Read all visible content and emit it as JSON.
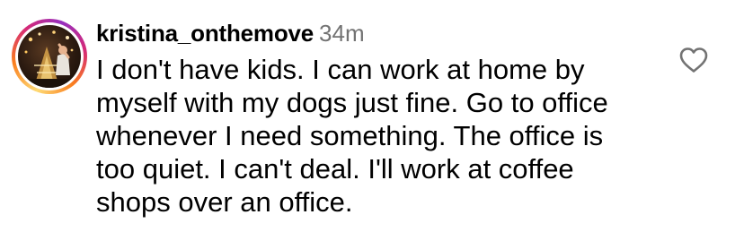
{
  "comment": {
    "username": "kristina_onthemove",
    "timestamp": "34m",
    "lines": [
      "I don't have kids. I can work at home by",
      "myself with my dogs just fine. Go to office",
      "whenever I need something. The office is",
      "too quiet. I can't deal. I'll work at coffee",
      "shops over an office."
    ],
    "like_icon": "heart-outline-icon"
  },
  "colors": {
    "text": "#000000",
    "muted": "#737373",
    "story_ring": [
      "#feda75",
      "#fa7e1e",
      "#d62976",
      "#962fbf"
    ]
  }
}
